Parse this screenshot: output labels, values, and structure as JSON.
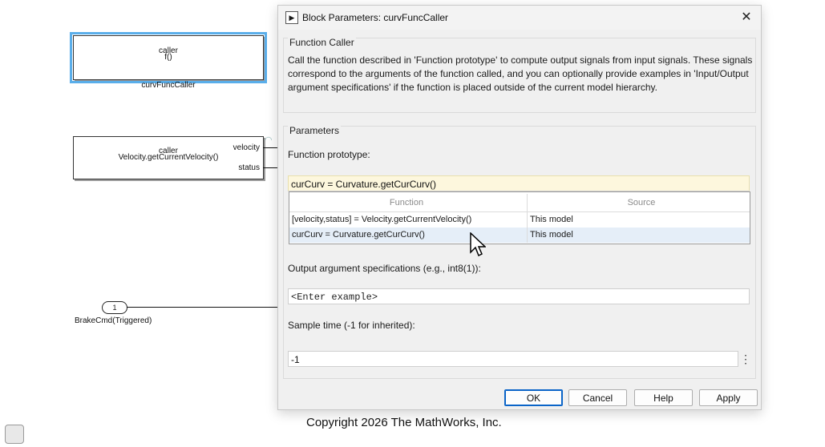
{
  "canvas": {
    "block1": {
      "top_text": "caller",
      "bottom_text": "f()",
      "name": "curvFuncCaller"
    },
    "block2": {
      "top_text": "caller",
      "bottom_text": "Velocity.getCurrentVelocity()",
      "ports": [
        "velocity",
        "status"
      ]
    },
    "inport": {
      "number": "1",
      "name": "BrakeCmd(Triggered)"
    }
  },
  "dialog": {
    "title": "Block Parameters: curvFuncCaller",
    "section_function_caller": "Function Caller",
    "description": "Call the function described in 'Function prototype' to compute output signals from input signals. These signals correspond to the arguments of the function called, and you can optionally provide examples in 'Input/Output argument specifications' if the function is placed outside of the current model hierarchy.",
    "section_parameters": "Parameters",
    "function_prototype_label": "Function prototype:",
    "function_prototype_value": "curCurv = Curvature.getCurCurv()",
    "dropdown": {
      "col_function": "Function",
      "col_source": "Source",
      "rows": [
        {
          "function": "[velocity,status] = Velocity.getCurrentVelocity()",
          "source": "This model"
        },
        {
          "function": "curCurv = Curvature.getCurCurv()",
          "source": "This model"
        }
      ]
    },
    "output_spec_label": "Output argument specifications (e.g., int8(1)):",
    "output_spec_placeholder": "<Enter example>",
    "sample_time_label": "Sample time (-1 for inherited):",
    "sample_time_value": "-1",
    "buttons": {
      "ok": "OK",
      "cancel": "Cancel",
      "help": "Help",
      "apply": "Apply"
    }
  },
  "footer": {
    "copyright": "Copyright 2026 The MathWorks, Inc."
  }
}
